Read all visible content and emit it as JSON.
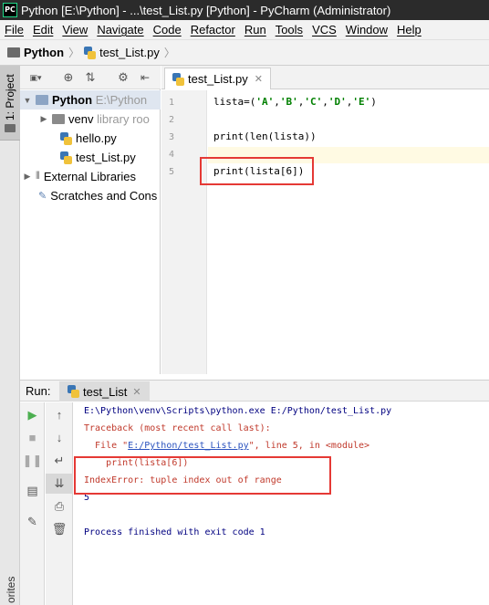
{
  "window": {
    "title": "Python [E:\\Python] - ...\\test_List.py [Python] - PyCharm (Administrator)",
    "app_badge": "PC"
  },
  "menu": [
    "File",
    "Edit",
    "View",
    "Navigate",
    "Code",
    "Refactor",
    "Run",
    "Tools",
    "VCS",
    "Window",
    "Help"
  ],
  "breadcrumb": {
    "project": "Python",
    "file": "test_List.py"
  },
  "side_tabs": {
    "project": "1: Project",
    "favorites": "orites"
  },
  "project_tree": {
    "root": {
      "name": "Python",
      "path": "E:\\Python"
    },
    "venv": {
      "name": "venv",
      "hint": "library roo"
    },
    "files": [
      "hello.py",
      "test_List.py"
    ],
    "external": "External Libraries",
    "scratches": "Scratches and Cons"
  },
  "editor": {
    "tab": "test_List.py",
    "line_numbers": [
      "1",
      "2",
      "3",
      "4",
      "5"
    ],
    "lines": [
      {
        "plain": "lista=(",
        "parts": [
          "'A'",
          ",",
          "'B'",
          ",",
          "'C'",
          ",",
          "'D'",
          ",",
          "'E'"
        ],
        "end": ")"
      },
      "",
      "print(len(lista))",
      "",
      "print(lista[6])"
    ]
  },
  "run": {
    "label": "Run:",
    "tab": "test_List",
    "console": {
      "cmd": "E:\\Python\\venv\\Scripts\\python.exe E:/Python/test_List.py",
      "traceback": "Traceback (most recent call last):",
      "file_prefix": "  File \"",
      "file_link": "E:/Python/test_List.py",
      "file_suffix": "\", line 5, in <module>",
      "code_line": "    print(lista[6])",
      "error": "IndexError: tuple index out of range",
      "output": "5",
      "exit": "Process finished with exit code 1"
    }
  },
  "colors": {
    "accent_red": "#e53935",
    "run_green": "#4caf50"
  }
}
